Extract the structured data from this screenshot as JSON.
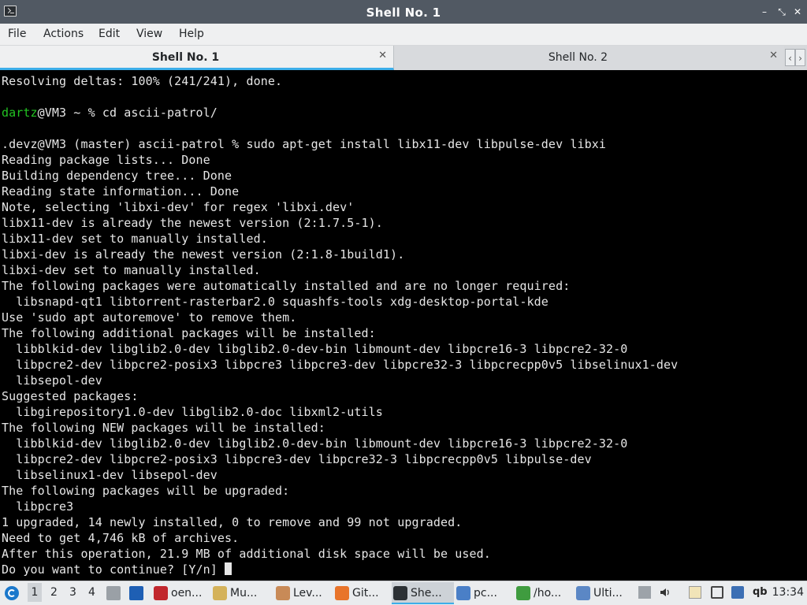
{
  "window": {
    "title": "Shell No. 1",
    "controls": {
      "minimize": "–",
      "maximize": "⤡",
      "close": "✕"
    }
  },
  "menu": {
    "items": [
      "File",
      "Actions",
      "Edit",
      "View",
      "Help"
    ]
  },
  "tabs": [
    {
      "label": "Shell No. 1",
      "active": true,
      "close": "✕"
    },
    {
      "label": "Shell No. 2",
      "active": false,
      "close": "✕"
    }
  ],
  "tab_scroll": {
    "left": "‹",
    "right": "›"
  },
  "terminal": {
    "lines": [
      "Resolving deltas: 100% (241/241), done.",
      "",
      {
        "user": "dartz",
        "rest": "@VM3 ~ % cd ascii-patrol/"
      },
      "",
      ".devz@VM3 (master) ascii-patrol % sudo apt-get install libx11-dev libpulse-dev libxi",
      "Reading package lists... Done",
      "Building dependency tree... Done",
      "Reading state information... Done",
      "Note, selecting 'libxi-dev' for regex 'libxi.dev'",
      "libx11-dev is already the newest version (2:1.7.5-1).",
      "libx11-dev set to manually installed.",
      "libxi-dev is already the newest version (2:1.8-1build1).",
      "libxi-dev set to manually installed.",
      "The following packages were automatically installed and are no longer required:",
      "  libsnapd-qt1 libtorrent-rasterbar2.0 squashfs-tools xdg-desktop-portal-kde",
      "Use 'sudo apt autoremove' to remove them.",
      "The following additional packages will be installed:",
      "  libblkid-dev libglib2.0-dev libglib2.0-dev-bin libmount-dev libpcre16-3 libpcre2-32-0",
      "  libpcre2-dev libpcre2-posix3 libpcre3 libpcre3-dev libpcre32-3 libpcrecpp0v5 libselinux1-dev",
      "  libsepol-dev",
      "Suggested packages:",
      "  libgirepository1.0-dev libglib2.0-doc libxml2-utils",
      "The following NEW packages will be installed:",
      "  libblkid-dev libglib2.0-dev libglib2.0-dev-bin libmount-dev libpcre16-3 libpcre2-32-0",
      "  libpcre2-dev libpcre2-posix3 libpcre3-dev libpcre32-3 libpcrecpp0v5 libpulse-dev",
      "  libselinux1-dev libsepol-dev",
      "The following packages will be upgraded:",
      "  libpcre3",
      "1 upgraded, 14 newly installed, 0 to remove and 99 not upgraded.",
      "Need to get 4,746 kB of archives.",
      "After this operation, 21.9 MB of additional disk space will be used.",
      "Do you want to continue? [Y/n] "
    ]
  },
  "taskbar": {
    "workspaces": [
      "1",
      "2",
      "3",
      "4"
    ],
    "tasks": [
      {
        "label": "oen...",
        "icon": "filezilla-icon",
        "color": "#c1272d"
      },
      {
        "label": "Mu...",
        "icon": "download-manager-icon",
        "color": "#d4b25a"
      },
      {
        "label": "Lev...",
        "icon": "character-icon",
        "color": "#c88a57"
      },
      {
        "label": "Git...",
        "icon": "firefox-icon",
        "color": "#e8742a"
      },
      {
        "label": "She...",
        "icon": "terminal-icon",
        "color": "#2c3135"
      },
      {
        "label": "pc...",
        "icon": "file-manager-icon",
        "color": "#4a7fc7"
      },
      {
        "label": "/ho...",
        "icon": "text-editor-icon",
        "color": "#3f9c3f"
      },
      {
        "label": "Ulti...",
        "icon": "window-icon",
        "color": "#5b87c5"
      }
    ],
    "clock": "13:34",
    "tray_text": "qb"
  }
}
